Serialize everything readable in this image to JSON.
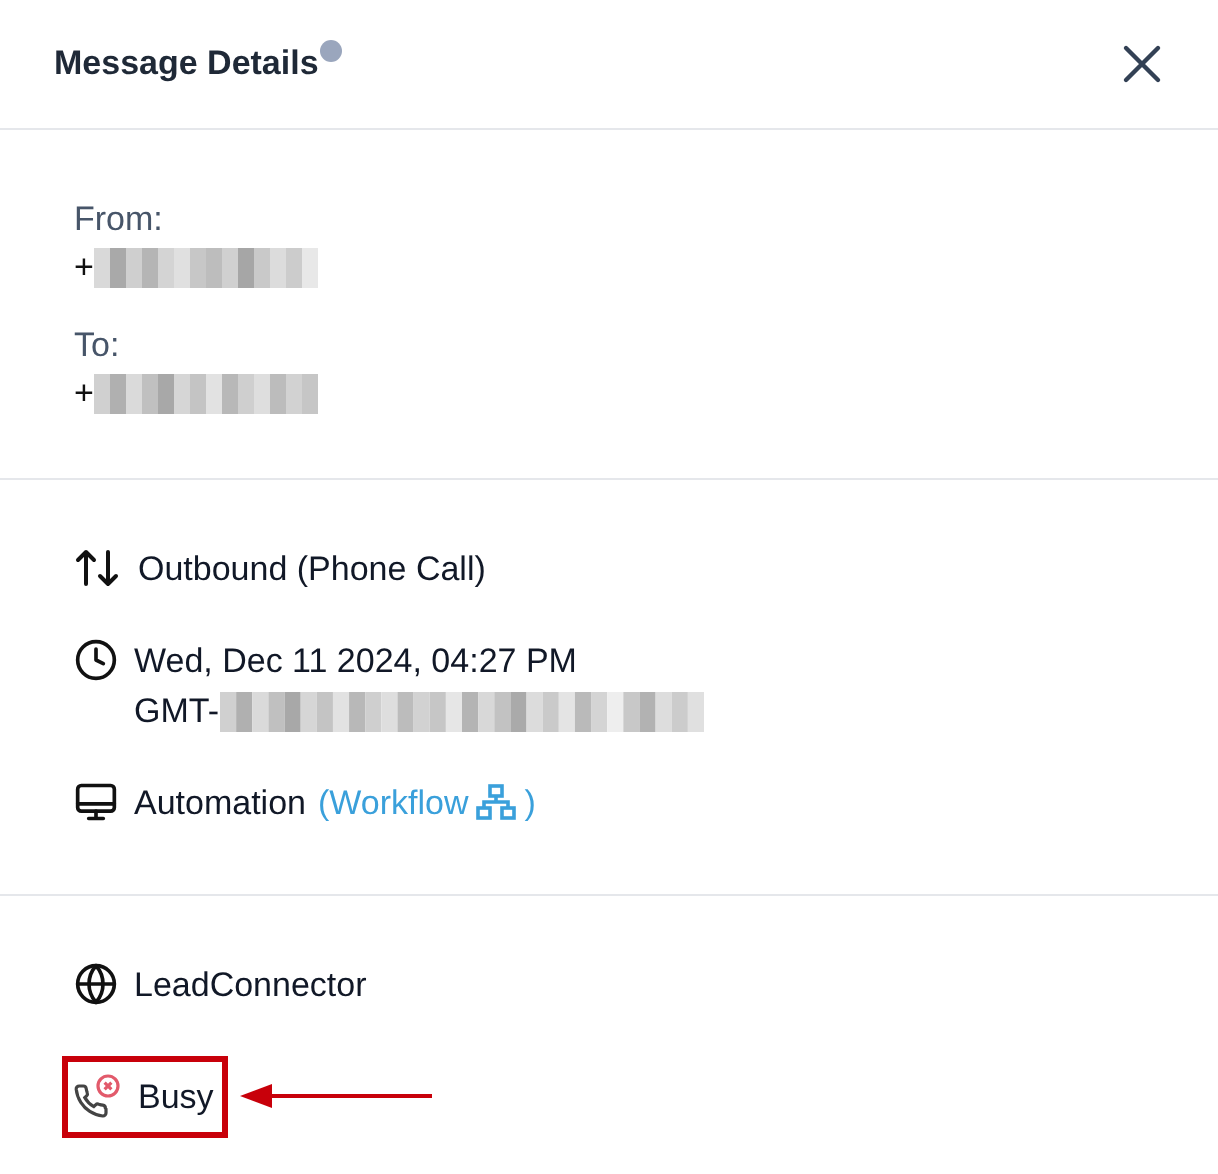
{
  "panel": {
    "title": "Message Details"
  },
  "contacts": [
    {
      "label": "From:",
      "value": "+"
    },
    {
      "label": "To:",
      "value": "+"
    }
  ],
  "details": [
    {
      "kind": "direction",
      "text": "Outbound (Phone Call)"
    },
    {
      "kind": "time",
      "text": "Wed, Dec 11 2024, 04:27 PM",
      "subtext": "GMT-"
    },
    {
      "kind": "source",
      "text": "Automation",
      "link": {
        "label": "(Workflow",
        "suffix": ")"
      }
    }
  ],
  "meta": [
    {
      "kind": "provider",
      "text": "LeadConnector",
      "highlighted": false
    },
    {
      "kind": "status",
      "text": "Busy",
      "highlighted": true
    }
  ]
}
